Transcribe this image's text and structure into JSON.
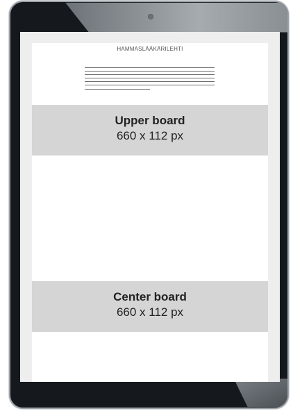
{
  "device": {
    "type": "tablet",
    "frame_color": "#15191d",
    "screen_background": "#eeeeee",
    "page_background": "#ffffff"
  },
  "page": {
    "masthead": "HAMMASLÄÄKÄRILEHTI",
    "text_line_count": 7
  },
  "boards": [
    {
      "name": "Upper board",
      "size": "660 x 112 px",
      "color": "#d5d5d5"
    },
    {
      "name": "Center board",
      "size": "660 x 112 px",
      "color": "#d5d5d5"
    }
  ]
}
